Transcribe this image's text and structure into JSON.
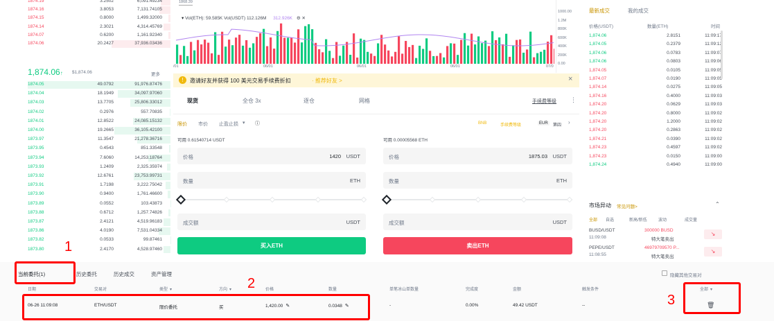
{
  "orderbook": {
    "asks": [
      {
        "price": "1874.19",
        "amount": "3.2502",
        "total": "6,091.49234"
      },
      {
        "price": "1874.16",
        "amount": "3.8053",
        "total": "7,131.74105"
      },
      {
        "price": "1874.15",
        "amount": "0.8000",
        "total": "1,499.32000"
      },
      {
        "price": "1874.14",
        "amount": "2.3021",
        "total": "4,314.45769"
      },
      {
        "price": "1874.07",
        "amount": "0.6200",
        "total": "1,161.92340"
      },
      {
        "price": "1874.06",
        "amount": "20.2427",
        "total": "37,936.03436"
      }
    ],
    "last_price": "1,874.06",
    "last_arrow": "↑",
    "last_usd": "$1,874.06",
    "more": "更多",
    "bids": [
      {
        "price": "1874.05",
        "amount": "49.0792",
        "total": "91,976.87476"
      },
      {
        "price": "1874.04",
        "amount": "18.1949",
        "total": "34,097.97060"
      },
      {
        "price": "1874.03",
        "amount": "13.7705",
        "total": "25,806.33012"
      },
      {
        "price": "1874.02",
        "amount": "0.2976",
        "total": "557.70835"
      },
      {
        "price": "1874.01",
        "amount": "12.8522",
        "total": "24,085.15132"
      },
      {
        "price": "1874.00",
        "amount": "19.2665",
        "total": "36,105.42100"
      },
      {
        "price": "1873.97",
        "amount": "11.3547",
        "total": "21,278.36716"
      },
      {
        "price": "1873.95",
        "amount": "0.4543",
        "total": "851.33548"
      },
      {
        "price": "1873.94",
        "amount": "7.6060",
        "total": "14,253.18764"
      },
      {
        "price": "1873.93",
        "amount": "1.2409",
        "total": "2,325.35974"
      },
      {
        "price": "1873.92",
        "amount": "12.6761",
        "total": "23,753.99731"
      },
      {
        "price": "1873.91",
        "amount": "1.7198",
        "total": "3,222.75042"
      },
      {
        "price": "1873.90",
        "amount": "0.9400",
        "total": "1,761.46600"
      },
      {
        "price": "1873.89",
        "amount": "0.0552",
        "total": "103.43873"
      },
      {
        "price": "1873.88",
        "amount": "0.6712",
        "total": "1,257.74826"
      },
      {
        "price": "1873.87",
        "amount": "2.4121",
        "total": "4,519.96183"
      },
      {
        "price": "1873.86",
        "amount": "4.0190",
        "total": "7,531.04334"
      },
      {
        "price": "1873.82",
        "amount": "0.0533",
        "total": "99.87461"
      },
      {
        "price": "1873.80",
        "amount": "2.4170",
        "total": "4,528.97460"
      }
    ]
  },
  "chart": {
    "legend": "Vol(ETH): 59.585K  Vol(USDT) 112.126M",
    "legend2": "312.926K",
    "top_label": "1868.39",
    "right_axis": [
      "1000.00",
      "1.2M",
      "800K",
      "600K",
      "400K",
      "200K",
      "0.00"
    ],
    "dates": [
      "/01",
      "06/01",
      "06/01",
      "06/01",
      "07/0"
    ]
  },
  "banner": {
    "text": "邀请好友并获得 100 美元交易手续费折扣",
    "link": "· 推荐好友 >",
    "close": "×"
  },
  "trade": {
    "tabs": [
      "现货",
      "全仓 3x",
      "逐仓",
      "网格"
    ],
    "tutorial": "手续费等级",
    "order_types": [
      "限价",
      "市价",
      "止盈止损"
    ],
    "right_links": [
      "BNB",
      "手续费等级"
    ],
    "right_link2": "EUR",
    "right_link3": "第四",
    "buy_avail": "可用  0.61540714 USDT",
    "sell_avail": "可用  0.00005568 ETH",
    "price_label": "价格",
    "buy_price": "1420",
    "sell_price": "1875.03",
    "usdt": "USDT",
    "eth": "ETH",
    "amount_label": "数量",
    "total_label": "成交额",
    "buy_btn": "买入ETH",
    "sell_btn": "卖出ETH"
  },
  "trades": {
    "tab1": "最新成交",
    "tab2": "我的成交",
    "headers": [
      "价格(USDT)",
      "数量(ETH)",
      "时间"
    ],
    "rows": [
      {
        "p": "1,874.06",
        "a": "2.8151",
        "t": "11:09:17",
        "c": "g"
      },
      {
        "p": "1,874.05",
        "a": "0.2379",
        "t": "11:09:12",
        "c": "g"
      },
      {
        "p": "1,874.06",
        "a": "0.0783",
        "t": "11:09:07",
        "c": "g"
      },
      {
        "p": "1,874.06",
        "a": "0.0803",
        "t": "11:09:06",
        "c": "g"
      },
      {
        "p": "1,874.05",
        "a": "0.0105",
        "t": "11:09:05",
        "c": "r"
      },
      {
        "p": "1,874.07",
        "a": "0.0190",
        "t": "11:09:05",
        "c": "r"
      },
      {
        "p": "1,874.14",
        "a": "0.0275",
        "t": "11:09:05",
        "c": "r"
      },
      {
        "p": "1,874.16",
        "a": "0.4000",
        "t": "11:09:03",
        "c": "r"
      },
      {
        "p": "1,874.20",
        "a": "0.0629",
        "t": "11:09:03",
        "c": "r"
      },
      {
        "p": "1,874.20",
        "a": "0.8000",
        "t": "11:09:02",
        "c": "r"
      },
      {
        "p": "1,874.20",
        "a": "1.2000",
        "t": "11:09:02",
        "c": "r"
      },
      {
        "p": "1,874.20",
        "a": "0.2863",
        "t": "11:09:02",
        "c": "r"
      },
      {
        "p": "1,874.21",
        "a": "0.0390",
        "t": "11:09:02",
        "c": "r"
      },
      {
        "p": "1,874.23",
        "a": "0.4597",
        "t": "11:09:02",
        "c": "r"
      },
      {
        "p": "1,874.23",
        "a": "0.0150",
        "t": "11:09:00",
        "c": "r"
      },
      {
        "p": "1,874.24",
        "a": "0.4940",
        "t": "11:09:00",
        "c": "g"
      }
    ]
  },
  "moves": {
    "title": "市场异动",
    "link": "常见问题>",
    "tabs": [
      "全部",
      "自选",
      "新高/新低",
      "波动",
      "成交量"
    ],
    "rows": [
      {
        "pair": "BUSD/USDT",
        "time": "11:09:08",
        "val": "300000 BUSD",
        "desc": "特大笔卖出"
      },
      {
        "pair": "PEPE/USDT",
        "time": "11:08:55",
        "val": "46979709570 P...",
        "desc": "特大笔卖出"
      }
    ]
  },
  "orders": {
    "tabs": [
      "当前委托(1)",
      "历史委托",
      "历史成交",
      "资产管理"
    ],
    "hide_label": "隐藏其他交易对",
    "headers": [
      "日期",
      "交易对",
      "类型",
      "方向",
      "价格",
      "数量",
      "单笔冰山单数量",
      "完成度",
      "金额",
      "触发条件",
      "全部"
    ],
    "row": {
      "date": "06-26 11:09:08",
      "pair": "ETH/USDT",
      "type": "限价委托",
      "side": "买",
      "price": "1,420.00",
      "qty": "0.0348",
      "iceberg": "-",
      "filled": "0.00%",
      "amount": "49.42 USDT",
      "trigger": "--"
    }
  },
  "annotations": [
    "1",
    "2",
    "3"
  ],
  "colors": {
    "green": "#0ecb81",
    "red": "#f6465d",
    "annot": "#ff0000"
  }
}
